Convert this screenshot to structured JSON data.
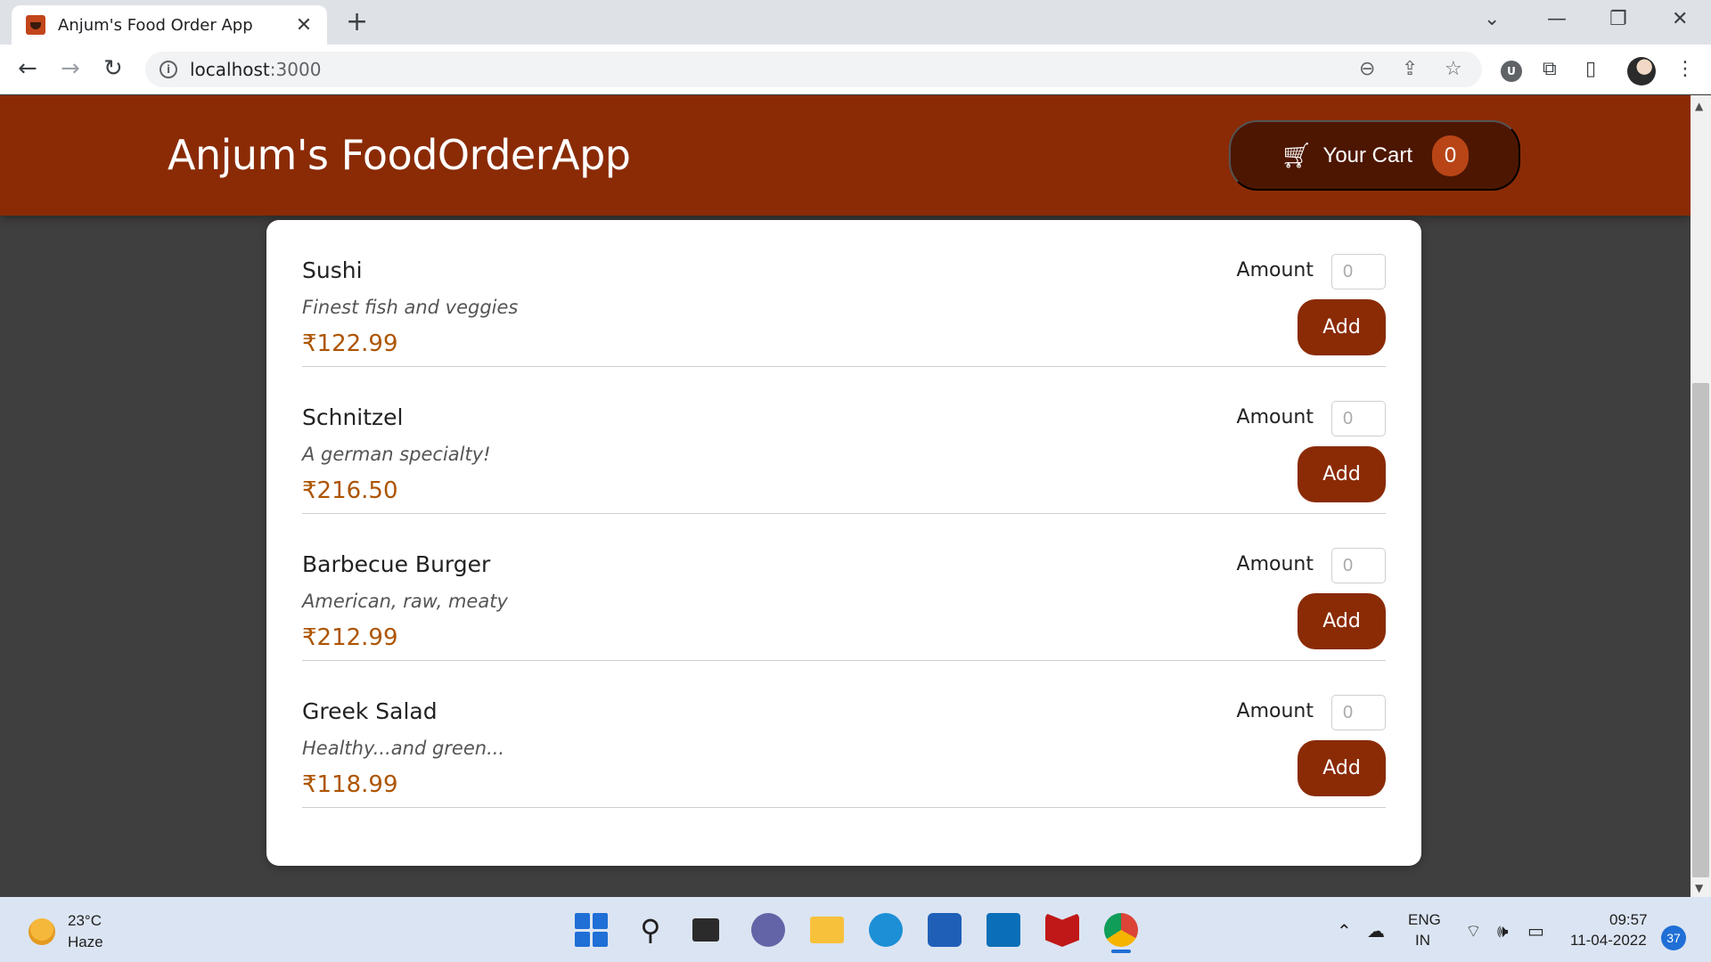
{
  "browser": {
    "tab_title": "Anjum's Food Order App",
    "url_host": "localhost",
    "url_port": ":3000",
    "extension_letter": "U"
  },
  "app": {
    "title": "Anjum's FoodOrderApp",
    "cart_label": "Your Cart",
    "cart_count": "0"
  },
  "meals": [
    {
      "name": "Sushi",
      "description": "Finest fish and veggies",
      "price": "₹122.99",
      "amount_label": "Amount",
      "amount_value": "0",
      "add_label": "Add"
    },
    {
      "name": "Schnitzel",
      "description": "A german specialty!",
      "price": "₹216.50",
      "amount_label": "Amount",
      "amount_value": "0",
      "add_label": "Add"
    },
    {
      "name": "Barbecue Burger",
      "description": "American, raw, meaty",
      "price": "₹212.99",
      "amount_label": "Amount",
      "amount_value": "0",
      "add_label": "Add"
    },
    {
      "name": "Greek Salad",
      "description": "Healthy...and green...",
      "price": "₹118.99",
      "amount_label": "Amount",
      "amount_value": "0",
      "add_label": "Add"
    }
  ],
  "taskbar": {
    "temperature": "23°C",
    "condition": "Haze",
    "lang_top": "ENG",
    "lang_bottom": "IN",
    "time": "09:57",
    "date": "11-04-2022",
    "notifications": "37"
  },
  "colors": {
    "header": "#8a2b06",
    "cart_button": "#4d1601",
    "cart_badge": "#b94517",
    "price": "#ad5502",
    "background": "#3f3f3f"
  }
}
